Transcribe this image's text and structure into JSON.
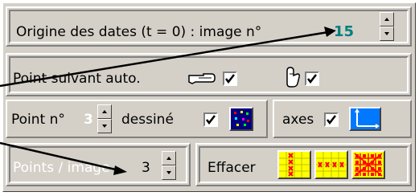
{
  "origin": {
    "label": "Origine des dates (t = 0) : image n°",
    "value": "15",
    "value_color": "#008080"
  },
  "auto": {
    "label": "Point suivant auto.",
    "hand_point_icon": "pointing-hand-icon",
    "hand_up_icon": "raised-hand-icon",
    "check1": true,
    "check2": true
  },
  "point": {
    "label": "Point n°",
    "number": "3",
    "number_color": "#ffffff",
    "drawn_label": "dessiné",
    "drawn_checked": true,
    "axes_label": "axes",
    "axes_checked": true
  },
  "per_image": {
    "label": "Points / image",
    "value": "3"
  },
  "clear": {
    "label": "Effacer"
  },
  "colors": {
    "panel_bg": "#d4d0c8",
    "dark_icon_bg": "#000080",
    "axes_icon_bg": "#0078ff",
    "grid_yellow": "#ffff00",
    "grid_red": "#ff0000"
  }
}
